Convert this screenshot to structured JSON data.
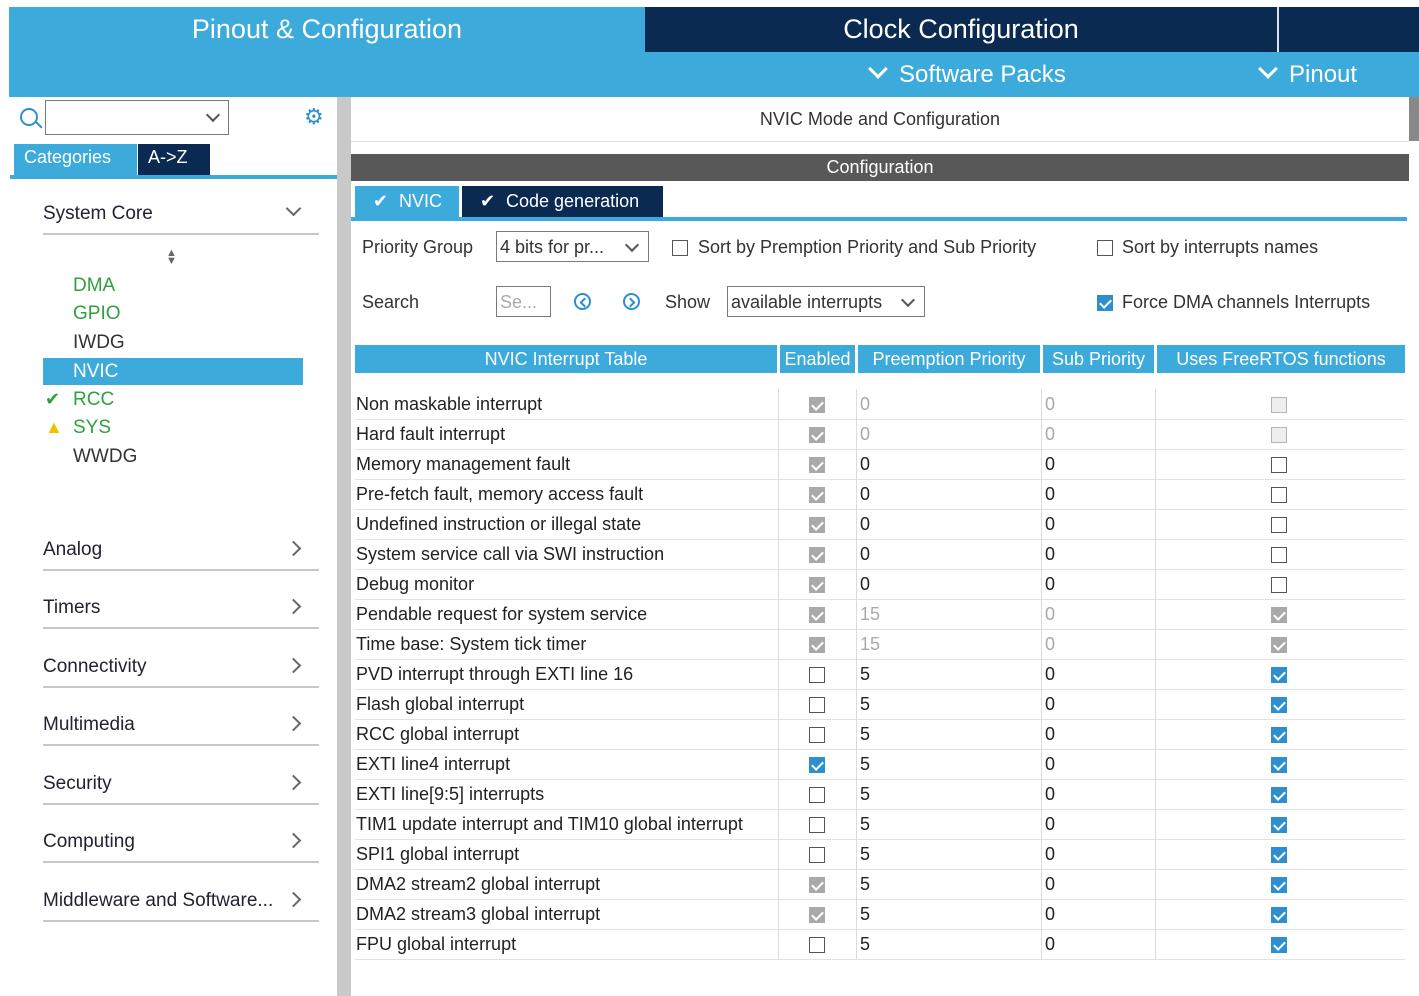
{
  "top_tabs": {
    "pinout": "Pinout & Configuration",
    "clock": "Clock Configuration"
  },
  "subbar": {
    "software_packs": "Software Packs",
    "pinout": "Pinout"
  },
  "left": {
    "tabs": {
      "categories": "Categories",
      "az": "A->Z"
    },
    "sections": {
      "system_core": "System Core",
      "analog": "Analog",
      "timers": "Timers",
      "connectivity": "Connectivity",
      "multimedia": "Multimedia",
      "security": "Security",
      "computing": "Computing",
      "middleware": "Middleware and Software..."
    },
    "peripherals": {
      "dma": "DMA",
      "gpio": "GPIO",
      "iwdg": "IWDG",
      "nvic": "NVIC",
      "rcc": "RCC",
      "sys": "SYS",
      "wwdg": "WWDG"
    }
  },
  "right": {
    "mode_title": "NVIC Mode and Configuration",
    "config_title": "Configuration",
    "tabs": {
      "nvic": "NVIC",
      "codegen": "Code generation"
    },
    "priority_group_label": "Priority Group",
    "priority_group_value": "4 bits for pr...",
    "sort_premption": "Sort by Premption Priority and Sub Priority",
    "sort_names": "Sort by interrupts names",
    "search_label": "Search",
    "search_placeholder": "Se...",
    "show_label": "Show",
    "show_value": "available interrupts",
    "force_dma": "Force DMA channels Interrupts",
    "force_dma_checked": true
  },
  "table": {
    "headers": {
      "name": "NVIC Interrupt Table",
      "enabled": "Enabled",
      "pre": "Preemption Priority",
      "sub": "Sub Priority",
      "rtos": "Uses FreeRTOS functions"
    },
    "rows": [
      {
        "name": "Non maskable interrupt",
        "enabled": "dison",
        "pre": "0",
        "sub": "0",
        "prio_grey": true,
        "rtos": "dis"
      },
      {
        "name": "Hard fault interrupt",
        "enabled": "dison",
        "pre": "0",
        "sub": "0",
        "prio_grey": true,
        "rtos": "dis"
      },
      {
        "name": "Memory management fault",
        "enabled": "dison",
        "pre": "0",
        "sub": "0",
        "prio_grey": false,
        "rtos": "off"
      },
      {
        "name": "Pre-fetch fault, memory access fault",
        "enabled": "dison",
        "pre": "0",
        "sub": "0",
        "prio_grey": false,
        "rtos": "off"
      },
      {
        "name": "Undefined instruction or illegal state",
        "enabled": "dison",
        "pre": "0",
        "sub": "0",
        "prio_grey": false,
        "rtos": "off"
      },
      {
        "name": "System service call via SWI instruction",
        "enabled": "dison",
        "pre": "0",
        "sub": "0",
        "prio_grey": false,
        "rtos": "off"
      },
      {
        "name": "Debug monitor",
        "enabled": "dison",
        "pre": "0",
        "sub": "0",
        "prio_grey": false,
        "rtos": "off"
      },
      {
        "name": "Pendable request for system service",
        "enabled": "dison",
        "pre": "15",
        "sub": "0",
        "prio_grey": true,
        "rtos": "dison"
      },
      {
        "name": "Time base: System tick timer",
        "enabled": "dison",
        "pre": "15",
        "sub": "0",
        "prio_grey": true,
        "rtos": "dison"
      },
      {
        "name": "PVD interrupt through EXTI line 16",
        "enabled": "off",
        "pre": "5",
        "sub": "0",
        "prio_grey": false,
        "rtos": "on"
      },
      {
        "name": "Flash global interrupt",
        "enabled": "off",
        "pre": "5",
        "sub": "0",
        "prio_grey": false,
        "rtos": "on"
      },
      {
        "name": "RCC global interrupt",
        "enabled": "off",
        "pre": "5",
        "sub": "0",
        "prio_grey": false,
        "rtos": "on"
      },
      {
        "name": "EXTI line4 interrupt",
        "enabled": "on",
        "pre": "5",
        "sub": "0",
        "prio_grey": false,
        "rtos": "on"
      },
      {
        "name": "EXTI line[9:5] interrupts",
        "enabled": "off",
        "pre": "5",
        "sub": "0",
        "prio_grey": false,
        "rtos": "on"
      },
      {
        "name": "TIM1 update interrupt and TIM10 global interrupt",
        "enabled": "off",
        "pre": "5",
        "sub": "0",
        "prio_grey": false,
        "rtos": "on"
      },
      {
        "name": "SPI1 global interrupt",
        "enabled": "off",
        "pre": "5",
        "sub": "0",
        "prio_grey": false,
        "rtos": "on"
      },
      {
        "name": "DMA2 stream2 global interrupt",
        "enabled": "dison",
        "pre": "5",
        "sub": "0",
        "prio_grey": false,
        "rtos": "on"
      },
      {
        "name": "DMA2 stream3 global interrupt",
        "enabled": "dison",
        "pre": "5",
        "sub": "0",
        "prio_grey": false,
        "rtos": "on"
      },
      {
        "name": "FPU global interrupt",
        "enabled": "off",
        "pre": "5",
        "sub": "0",
        "prio_grey": false,
        "rtos": "on"
      }
    ]
  },
  "colors": {
    "accent": "#3daadc",
    "navy": "#0a2a52",
    "green": "#2fa040",
    "warn": "#f2c200"
  }
}
